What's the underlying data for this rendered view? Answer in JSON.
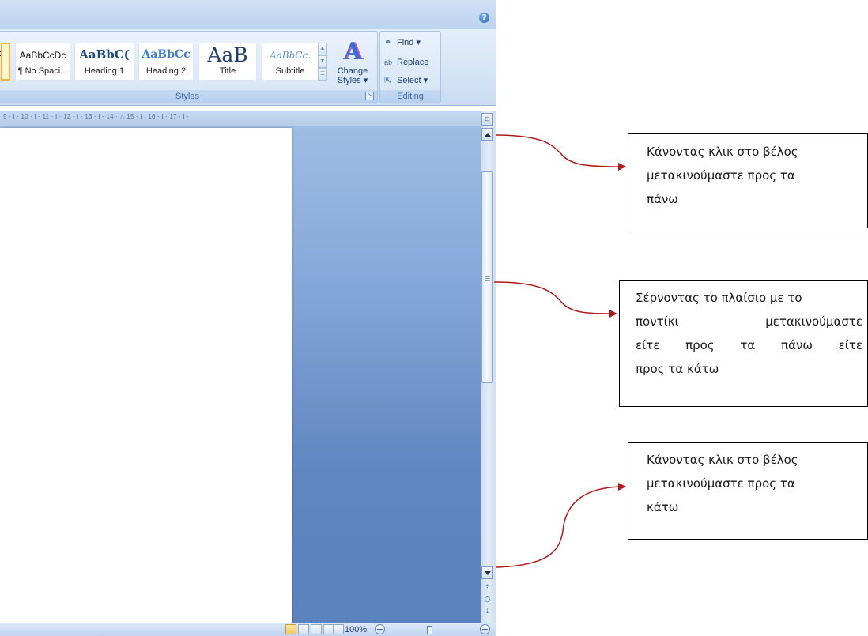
{
  "ribbon": {
    "help_icon": "?",
    "styles_group": {
      "label": "Styles",
      "tiles": [
        {
          "sample": "AaBbCcDc",
          "name": "¶ No Spaci..."
        },
        {
          "sample": "AaBbC(",
          "name": "Heading 1"
        },
        {
          "sample": "AaBbCc",
          "name": "Heading 2"
        },
        {
          "sample": "AaB",
          "name": "Title"
        },
        {
          "sample": "AaBbCc.",
          "name": "Subtitle"
        }
      ],
      "change_styles": {
        "icon": "A",
        "line1": "Change",
        "line2": "Styles ▾"
      }
    },
    "editing_group": {
      "label": "Editing",
      "find": "Find ▾",
      "replace": "Replace",
      "select": "Select ▾"
    }
  },
  "ruler": {
    "ticks": "9 · I · 10 · I · 11 · I · 12 · I · 13 · I · 14 · △ 15 · I · 16 · I · 17 · I ·"
  },
  "statusbar": {
    "zoom": "100%",
    "zoom_out": "−",
    "zoom_in": "+"
  },
  "callouts": {
    "scroll_up": {
      "lines": [
        "Κάνοντας κλικ στο βέλος",
        "μετακινούμαστε προς τα",
        "πάνω"
      ]
    },
    "drag_thumb": {
      "lines": [
        "Σέρνοντας το πλαίσιο με το",
        "ποντίκι μετακινούμαστε",
        "είτε προς τα πάνω είτε",
        "προς τα κάτω"
      ]
    },
    "scroll_down": {
      "lines": [
        "Κάνοντας κλικ στο βέλος",
        "μετακινούμαστε προς τα",
        "κάτω"
      ]
    }
  },
  "colors": {
    "arrow": "#b01a1a",
    "accent": "#3a6ed0",
    "selected_tile": "#f2b33d"
  }
}
